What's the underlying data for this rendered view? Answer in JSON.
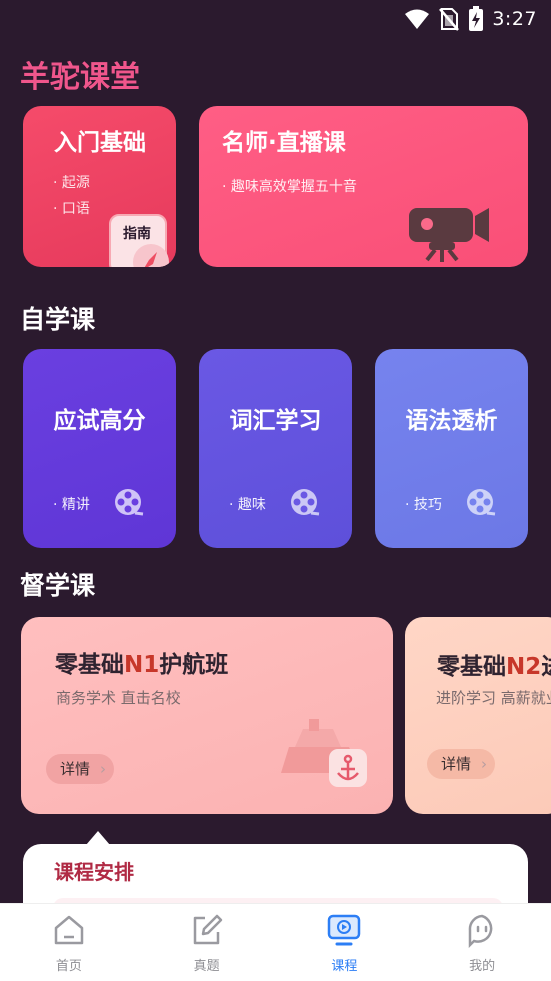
{
  "status_bar": {
    "time": "3:27"
  },
  "app": {
    "title": "羊驼课堂"
  },
  "featured": {
    "intro": {
      "title": "入门基础",
      "points": [
        "· 起源",
        "· 口语"
      ],
      "tag": "指南"
    },
    "live": {
      "title": "名师·直播课",
      "subtitle": "· 趣味高效掌握五十音"
    }
  },
  "self_study": {
    "title": "自学课",
    "cards": [
      {
        "title": "应试高分",
        "sub": "· 精讲",
        "color": "#6a3fe0"
      },
      {
        "title": "词汇学习",
        "sub": "· 趣味",
        "color": "#6a58e4"
      },
      {
        "title": "语法透析",
        "sub": "· 技巧",
        "color": "#7683ee"
      }
    ]
  },
  "supervised": {
    "title": "督学课",
    "cards": [
      {
        "title_pre": "零基础",
        "title_hl": "N1",
        "title_post": "护航班",
        "sub": "商务学术 直击名校",
        "detail": "详情",
        "chev": "›"
      },
      {
        "title_pre": "零基础",
        "title_hl": "N2",
        "title_post": "进",
        "sub": "进阶学习 高薪就业",
        "detail": "详情",
        "chev": "›"
      }
    ]
  },
  "schedule": {
    "title": "课程安排"
  },
  "nav": {
    "items": [
      {
        "label": "首页"
      },
      {
        "label": "真题"
      },
      {
        "label": "课程"
      },
      {
        "label": "我的"
      }
    ]
  },
  "colors": {
    "brand_pink": "#f0568c",
    "nav_active": "#2c7ef5",
    "background": "#2b1a2e"
  }
}
